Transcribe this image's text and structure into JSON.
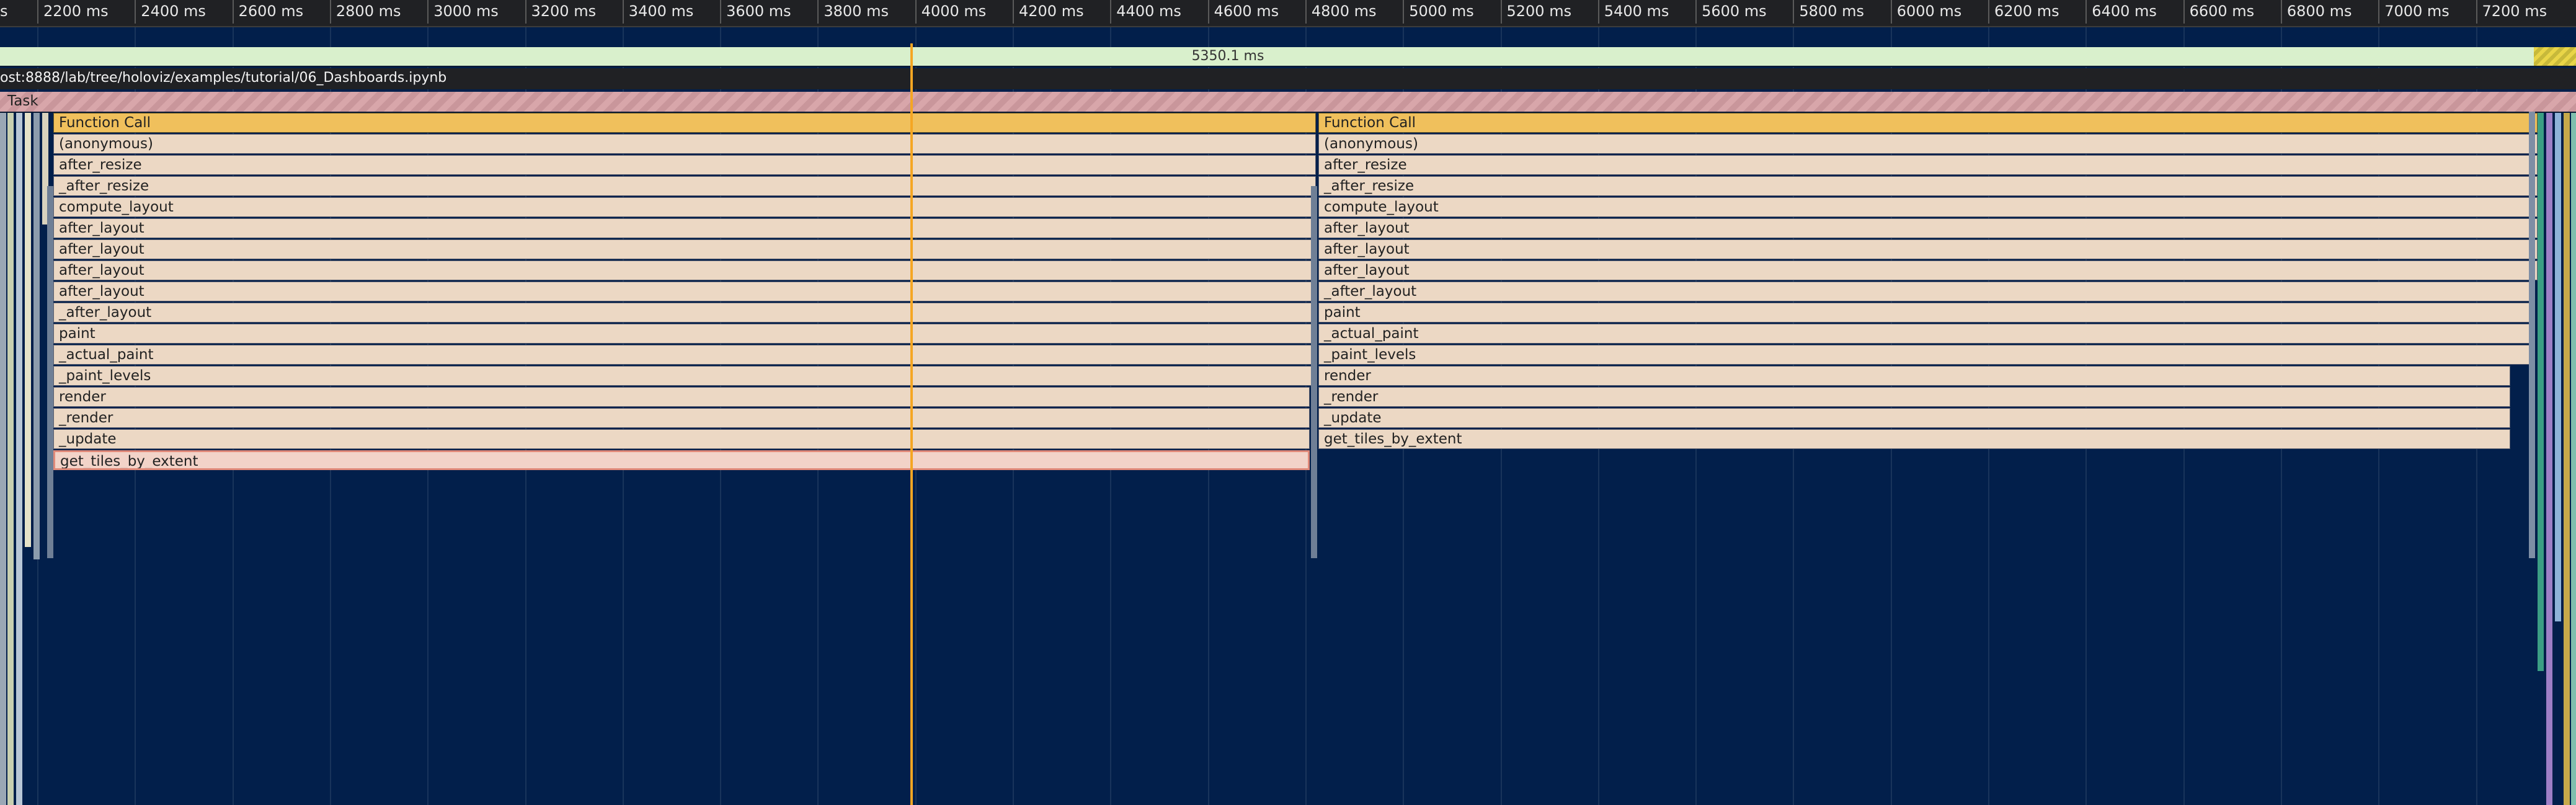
{
  "ruler": {
    "first_label": "s",
    "ticks": [
      "2200 ms",
      "2400 ms",
      "2600 ms",
      "2800 ms",
      "3000 ms",
      "3200 ms",
      "3400 ms",
      "3600 ms",
      "3800 ms",
      "4000 ms",
      "4200 ms",
      "4400 ms",
      "4600 ms",
      "4800 ms",
      "5000 ms",
      "5200 ms",
      "5400 ms",
      "5600 ms",
      "5800 ms",
      "6000 ms",
      "6200 ms",
      "6400 ms",
      "6600 ms",
      "6800 ms",
      "7000 ms",
      "7200 ms"
    ]
  },
  "frames": {
    "duration": "5350.1 ms"
  },
  "url_track": {
    "text": "ost:8888/lab/tree/holoviz/examples/tutorial/06_Dashboards.ipynb"
  },
  "task": {
    "label": "Task"
  },
  "left_stack": {
    "header": "Function Call",
    "items": [
      "(anonymous)",
      "after_resize",
      "_after_resize",
      "compute_layout",
      "after_layout",
      "after_layout",
      "after_layout",
      "after_layout",
      "_after_layout",
      "paint",
      "_actual_paint",
      "_paint_levels",
      "render",
      "_render",
      "_update",
      "get_tiles_by_extent"
    ]
  },
  "right_stack": {
    "header": "Function Call",
    "items": [
      "(anonymous)",
      "after_resize",
      "_after_resize",
      "compute_layout",
      "after_layout",
      "after_layout",
      "after_layout",
      "_after_layout",
      "paint",
      "_actual_paint",
      "_paint_levels",
      "render",
      "_render",
      "_update",
      "get_tiles_by_extent"
    ]
  },
  "colors": {
    "background": "#021f4b",
    "function_call": "#f0c05c",
    "frame_bar": "#ecd8c4",
    "task": "#d8a6aa",
    "selected_border": "#e08a7a",
    "cursor": "#f5a623"
  }
}
